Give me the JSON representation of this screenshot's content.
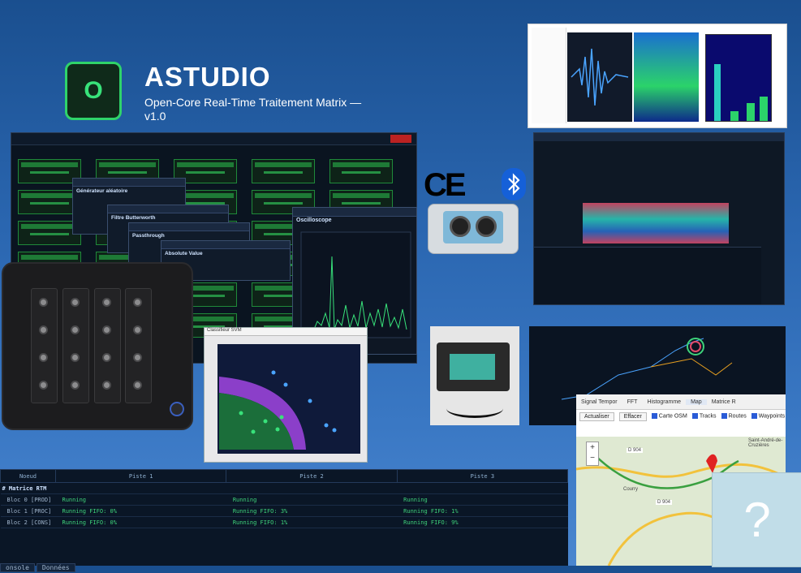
{
  "brand": {
    "logo_letter": "O",
    "title": "ASTUDIO",
    "subtitle": "Open-Core Real-Time Traitement Matrix —\nv1.0"
  },
  "matrix_window": {
    "popups": [
      {
        "title": "Générateur aléatoire"
      },
      {
        "title": "Filtre Butterworth"
      },
      {
        "title": "Passthrough"
      },
      {
        "title": "Absolute Value"
      }
    ],
    "oscilloscope_title": "Oscilloscope",
    "scatter_title": "Classifieur SVM"
  },
  "console": {
    "headers": [
      "Noeud",
      "Piste 1",
      "Piste 2",
      "Piste 3"
    ],
    "group_label": "# Matrice RTM",
    "rows": [
      {
        "node": "Bloc 0  [PROD]",
        "p1": "Running",
        "p2": "Running",
        "p3": "Running"
      },
      {
        "node": "Bloc 1  [PROC]",
        "p1": "Running  FIFO:  0%",
        "p2": "Running  FIFO:  3%",
        "p3": "Running  FIFO:  1%"
      },
      {
        "node": "Bloc 2  [CONS]",
        "p1": "Running  FIFO:  0%",
        "p2": "Running  FIFO:  1%",
        "p3": "Running  FIFO:  9%"
      }
    ],
    "tabs": [
      "onsole",
      "Données"
    ]
  },
  "badges": {
    "ce": "CE"
  },
  "map_window": {
    "tabs": [
      "Signal Tempor",
      "FFT",
      "Histogramme",
      "Map",
      "Matrice R"
    ],
    "tools": {
      "refresh": "Actualiser",
      "clear": "Effacer",
      "layers": [
        "Carte OSM",
        "Tracks",
        "Routes",
        "Waypoints"
      ]
    },
    "place_labels": [
      "Saint-André-de-Cruzières",
      "Courry",
      "D 904",
      "D 904"
    ]
  },
  "placeholder_mark": "?",
  "colors": {
    "accent_green": "#2fd36a",
    "background_top": "#1a4f8f",
    "bluetooth": "#1560d8"
  }
}
